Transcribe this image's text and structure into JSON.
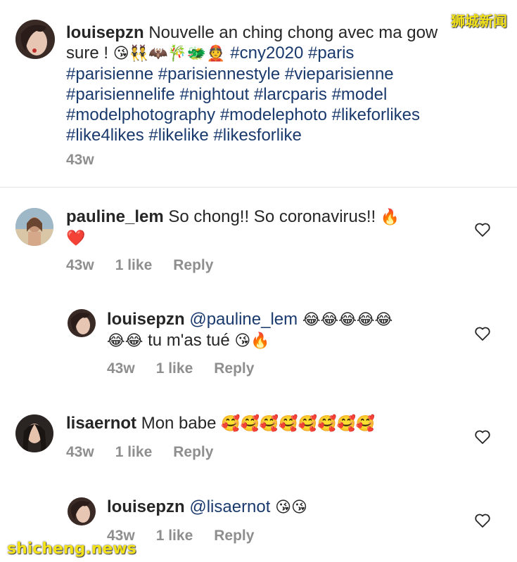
{
  "watermark_top": "狮城新闻",
  "watermark_bottom": "shicheng.news",
  "caption": {
    "username": "louisepzn",
    "text_line1": "Nouvelle an ching chong avec ma gow",
    "text_line2_prefix": "sure !",
    "emojis_line2": "😘👯🦇🎋🐲👲",
    "hashtag_cny": "#cny2020",
    "hashtag_paris": "#paris",
    "hashtags_line3": "#parisienne #parisiennestyle #vieparisienne",
    "hashtags_line4": "#parisiennelife #nightout #larcparis #model",
    "hashtags_line5": "#modelphotography #modelephoto #likeforlikes",
    "hashtags_line6": "#like4likes #likelike #likesforlike",
    "time": "43w"
  },
  "comments": [
    {
      "username": "pauline_lem",
      "text": "So chong!! So coronavirus!!",
      "emoji_inline": "🔥",
      "emoji_line2": "❤️",
      "time": "43w",
      "likes": "1 like",
      "reply": "Reply"
    },
    {
      "username": "louisepzn",
      "mention": "@pauline_lem",
      "emoji_line1": "😂😂😂😂😂",
      "emoji_line2_prefix": "😂😂",
      "text": "tu m'as tué",
      "emoji_line2_suffix": "😘🔥",
      "time": "43w",
      "likes": "1 like",
      "reply": "Reply"
    },
    {
      "username": "lisaernot",
      "text": "Mon babe",
      "emojis": "🥰🥰🥰🥰🥰🥰🥰🥰",
      "time": "43w",
      "likes": "1 like",
      "reply": "Reply"
    },
    {
      "username": "louisepzn",
      "mention": "@lisaernot",
      "emojis": "😘😘",
      "time": "43w",
      "likes": "1 like",
      "reply": "Reply"
    }
  ]
}
